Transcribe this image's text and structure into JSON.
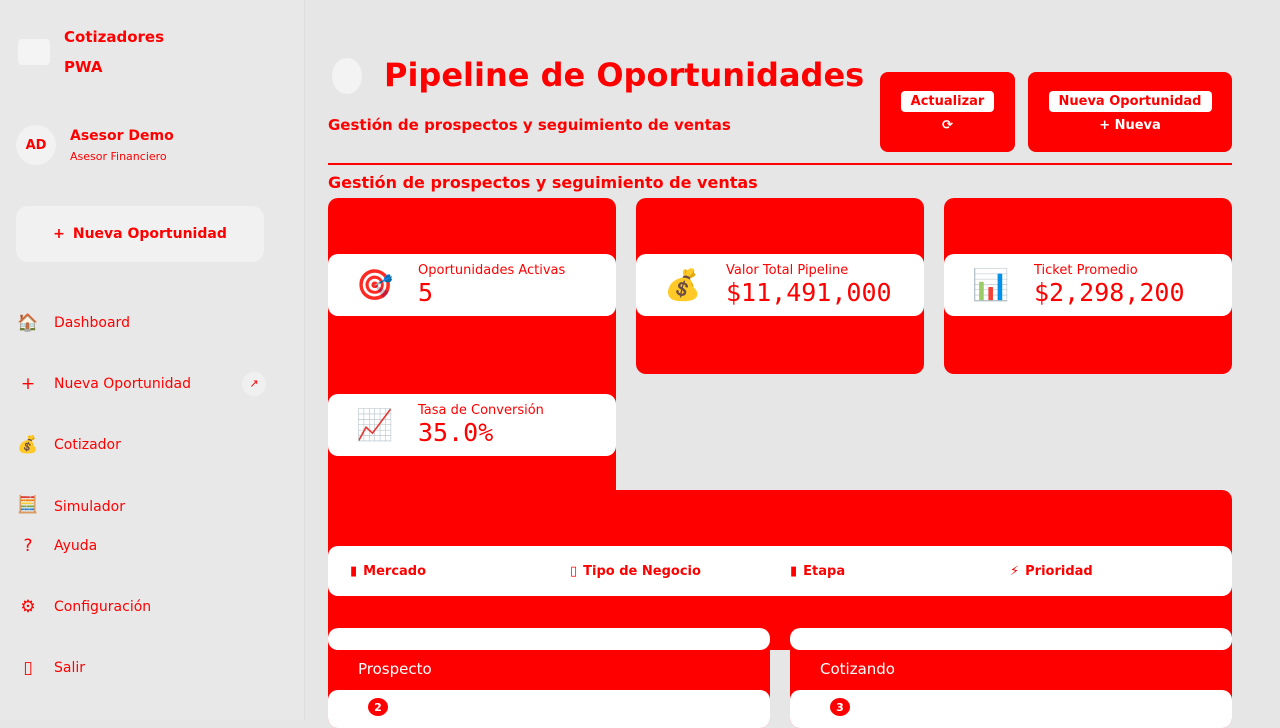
{
  "brand": {
    "line1": "Cotizadores",
    "line2": "PWA"
  },
  "user": {
    "initials": "AD",
    "name": "Asesor Demo",
    "role": "Asesor Financiero"
  },
  "sidebar": {
    "new_button": "Nueva Oportunidad",
    "items": [
      {
        "label": "Dashboard",
        "icon": "🏠"
      },
      {
        "label": "Nueva Oportunidad",
        "icon": "+",
        "badge": "↗"
      },
      {
        "label": "Cotizador",
        "icon": "💰"
      },
      {
        "label": "Simulador",
        "icon": "🧮"
      },
      {
        "label": "Ayuda",
        "icon": "?"
      },
      {
        "label": "Configuración",
        "icon": "⚙"
      },
      {
        "label": "Salir",
        "icon": "▯"
      }
    ]
  },
  "header": {
    "title": "Pipeline de Oportunidades",
    "subtitle": "Gestión de prospectos y seguimiento de ventas",
    "refresh": "Actualizar",
    "refresh_short": "⟳",
    "new": "Nueva Oportunidad",
    "new_short": "+ Nueva"
  },
  "stats": [
    {
      "label": "Oportunidades Activas",
      "value": "5",
      "icon": "🎯"
    },
    {
      "label": "Valor Total Pipeline",
      "value": "$11,491,000",
      "icon": "💰"
    },
    {
      "label": "Ticket Promedio",
      "value": "$2,298,200",
      "icon": "📊"
    },
    {
      "label": "Tasa de Conversión",
      "value": "35.0%",
      "icon": "📈"
    }
  ],
  "filters": [
    {
      "label": "Mercado",
      "icon": "▮"
    },
    {
      "label": "Tipo de Negocio",
      "icon": "▯"
    },
    {
      "label": "Etapa",
      "icon": "▮"
    },
    {
      "label": "Prioridad",
      "icon": "⚡"
    }
  ],
  "columns": [
    {
      "title": "Prospecto",
      "count": "2"
    },
    {
      "title": "Cotizando",
      "count": "3"
    }
  ]
}
